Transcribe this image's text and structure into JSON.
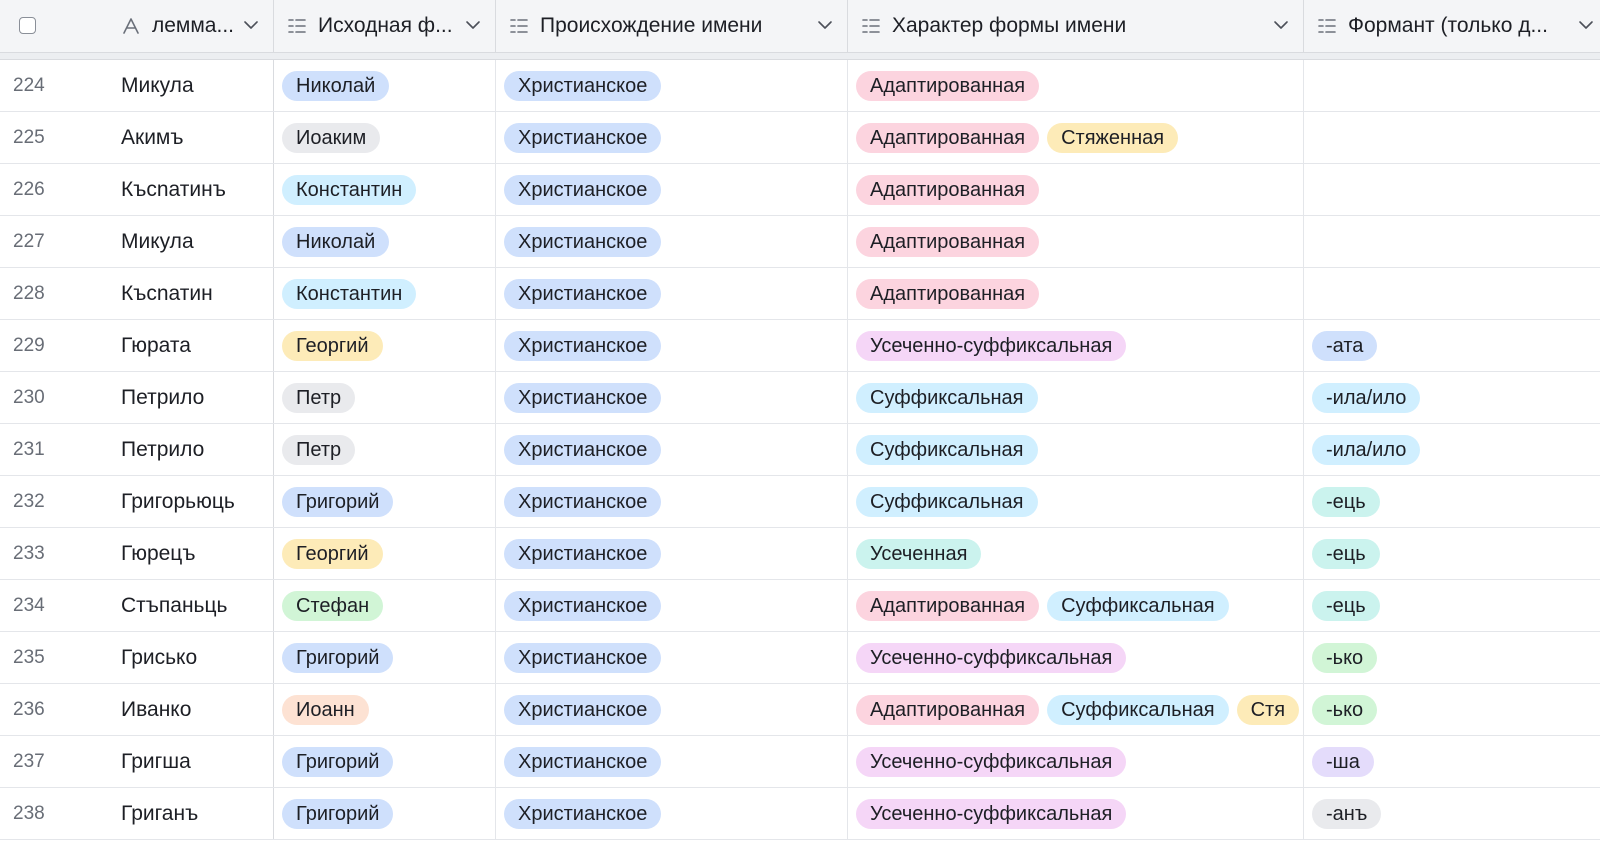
{
  "colors": {
    "blue": "#cfe0fc",
    "sky": "#d0efff",
    "gray": "#e9eaed",
    "yellow": "#fdebb8",
    "green": "#d1f5d6",
    "peach": "#fde2d3",
    "pink": "#fcd4df",
    "purple": "#f5d6f7",
    "teal": "#cbf3ee",
    "cyan": "#d0efff",
    "lilac": "#e4dcfb",
    "lightgray": "#e9eaed"
  },
  "header": {
    "checkbox": "select-all",
    "columns": [
      {
        "key": "lemma",
        "label": "лемма...",
        "icon": "formula-icon"
      },
      {
        "key": "source",
        "label": "Исходная ф...",
        "icon": "multi-select-icon"
      },
      {
        "key": "origin",
        "label": "Происхождение имени",
        "icon": "multi-select-icon"
      },
      {
        "key": "character",
        "label": "Характер формы имени",
        "icon": "multi-select-icon"
      },
      {
        "key": "formant",
        "label": "Формант (только д...",
        "icon": "multi-select-icon"
      }
    ]
  },
  "rows": [
    {
      "num": "224",
      "lemma": "Микула",
      "source": {
        "text": "Николай",
        "color": "blue"
      },
      "origin": "Христианское",
      "character": [
        {
          "text": "Адаптированная",
          "color": "pink"
        }
      ],
      "formant": null
    },
    {
      "num": "225",
      "lemma": "Акимъ",
      "source": {
        "text": "Иоаким",
        "color": "gray"
      },
      "origin": "Христианское",
      "character": [
        {
          "text": "Адаптированная",
          "color": "pink"
        },
        {
          "text": "Стяженная",
          "color": "yellow"
        }
      ],
      "formant": null
    },
    {
      "num": "226",
      "lemma": "Късnатинъ",
      "source": {
        "text": "Константин",
        "color": "sky"
      },
      "origin": "Христианское",
      "character": [
        {
          "text": "Адаптированная",
          "color": "pink"
        }
      ],
      "formant": null
    },
    {
      "num": "227",
      "lemma": "Микула",
      "source": {
        "text": "Николай",
        "color": "blue"
      },
      "origin": "Христианское",
      "character": [
        {
          "text": "Адаптированная",
          "color": "pink"
        }
      ],
      "formant": null
    },
    {
      "num": "228",
      "lemma": "Късnатин",
      "source": {
        "text": "Константин",
        "color": "sky"
      },
      "origin": "Христианское",
      "character": [
        {
          "text": "Адаптированная",
          "color": "pink"
        }
      ],
      "formant": null
    },
    {
      "num": "229",
      "lemma": "Гюрата",
      "source": {
        "text": "Георгий",
        "color": "yellow"
      },
      "origin": "Христианское",
      "character": [
        {
          "text": "Усеченно-суффиксальная",
          "color": "purple"
        }
      ],
      "formant": {
        "text": "-ата",
        "color": "blue"
      }
    },
    {
      "num": "230",
      "lemma": "Петрило",
      "source": {
        "text": "Петр",
        "color": "gray"
      },
      "origin": "Христианское",
      "character": [
        {
          "text": "Суффиксальная",
          "color": "cyan"
        }
      ],
      "formant": {
        "text": "-ила/ило",
        "color": "cyan"
      }
    },
    {
      "num": "231",
      "lemma": "Петрило",
      "source": {
        "text": "Петр",
        "color": "gray"
      },
      "origin": "Христианское",
      "character": [
        {
          "text": "Суффиксальная",
          "color": "cyan"
        }
      ],
      "formant": {
        "text": "-ила/ило",
        "color": "cyan"
      }
    },
    {
      "num": "232",
      "lemma": "Григорьюць",
      "source": {
        "text": "Григорий",
        "color": "blue"
      },
      "origin": "Христианское",
      "character": [
        {
          "text": "Суффиксальная",
          "color": "cyan"
        }
      ],
      "formant": {
        "text": "-ець",
        "color": "teal"
      }
    },
    {
      "num": "233",
      "lemma": "Гюрецъ",
      "source": {
        "text": "Георгий",
        "color": "yellow"
      },
      "origin": "Христианское",
      "character": [
        {
          "text": "Усеченная",
          "color": "teal"
        }
      ],
      "formant": {
        "text": "-ець",
        "color": "teal"
      }
    },
    {
      "num": "234",
      "lemma": "Стъпаньць",
      "source": {
        "text": "Стефан",
        "color": "green"
      },
      "origin": "Христианское",
      "character": [
        {
          "text": "Адаптированная",
          "color": "pink"
        },
        {
          "text": "Суффиксальная",
          "color": "cyan"
        }
      ],
      "formant": {
        "text": "-ець",
        "color": "teal"
      }
    },
    {
      "num": "235",
      "lemma": "Грисько",
      "source": {
        "text": "Григорий",
        "color": "blue"
      },
      "origin": "Христианское",
      "character": [
        {
          "text": "Усеченно-суффиксальная",
          "color": "purple"
        }
      ],
      "formant": {
        "text": "-ько",
        "color": "green"
      }
    },
    {
      "num": "236",
      "lemma": "Иванко",
      "source": {
        "text": "Иоанн",
        "color": "peach"
      },
      "origin": "Христианское",
      "character": [
        {
          "text": "Адаптированная",
          "color": "pink"
        },
        {
          "text": "Суффиксальная",
          "color": "cyan"
        },
        {
          "text": "Стя",
          "color": "yellow"
        }
      ],
      "formant": {
        "text": "-ько",
        "color": "green"
      }
    },
    {
      "num": "237",
      "lemma": "Григша",
      "source": {
        "text": "Григорий",
        "color": "blue"
      },
      "origin": "Христианское",
      "character": [
        {
          "text": "Усеченно-суффиксальная",
          "color": "purple"
        }
      ],
      "formant": {
        "text": "-ша",
        "color": "lilac"
      }
    },
    {
      "num": "238",
      "lemma": "Григанъ",
      "source": {
        "text": "Григорий",
        "color": "blue"
      },
      "origin": "Христианское",
      "character": [
        {
          "text": "Усеченно-суффиксальная",
          "color": "purple"
        }
      ],
      "formant": {
        "text": "-анъ",
        "color": "lightgray"
      }
    }
  ]
}
